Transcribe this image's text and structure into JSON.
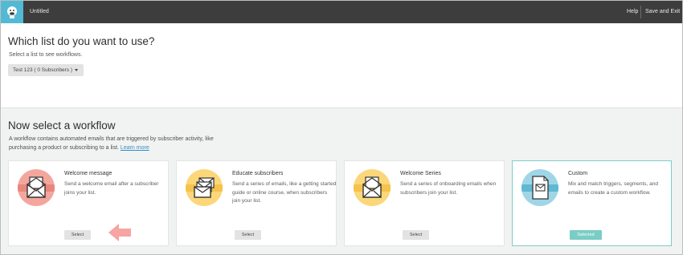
{
  "topbar": {
    "title": "Untitled",
    "help": "Help",
    "save_exit": "Save and Exit"
  },
  "list_section": {
    "heading": "Which list do you want to use?",
    "subtext": "Select a list to see workflows.",
    "dropdown_value": "Test 123 ( 0 Subscribers )"
  },
  "workflow_section": {
    "heading": "Now select a workflow",
    "description": "A workflow contains automated emails that are triggered by subscriber activity, like purchasing a product or subscribing to a list.",
    "learn_more": "Learn more"
  },
  "cards": [
    {
      "title": "Welcome message",
      "description": "Send a welcome email after a subscriber joins your list.",
      "button": "Select",
      "icon": "envelope-open-icon",
      "circle_color": "#f4a69d",
      "band_color": "#e8877d"
    },
    {
      "title": "Educate subscribers",
      "description": "Send a series of emails, like a getting started guide or online course, when subscribers join your list.",
      "button": "Select",
      "icon": "stacked-envelopes-icon",
      "circle_color": "#fcd77a",
      "band_color": "#f5c24c"
    },
    {
      "title": "Welcome Series",
      "description": "Send a series of onboarding emails when subscribers join your list.",
      "button": "Select",
      "icon": "envelope-open-icon",
      "circle_color": "#fcd77a",
      "band_color": "#f5c24c"
    },
    {
      "title": "Custom",
      "description": "Mix and match triggers, segments, and emails to create a custom workflow.",
      "button": "Selected",
      "icon": "custom-document-icon",
      "circle_color": "#9ed6e7",
      "band_color": "#5fb8d4"
    }
  ],
  "colors": {
    "topbar": "#3d3d3d",
    "logo_bg": "#52bad5",
    "selected_border": "#7fcdc8",
    "selected_button": "#79cdc5",
    "arrow": "#f6a5a3",
    "link": "#3b8cc4"
  }
}
